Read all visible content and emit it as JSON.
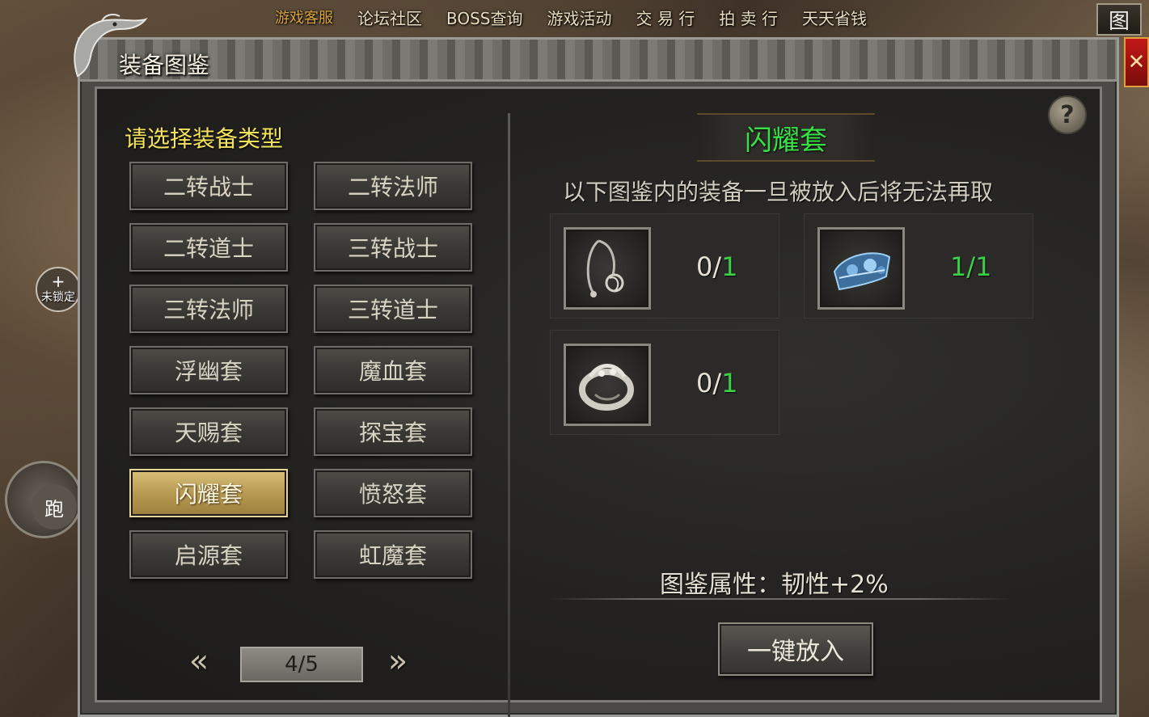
{
  "topbar": {
    "items": [
      "游戏客服",
      "论坛社区",
      "BOSS查询",
      "游戏活动",
      "交 易 行",
      "拍 卖 行",
      "天天省钱"
    ],
    "map_label": "图"
  },
  "hud": {
    "lock_label": "未锁定",
    "run_label": "跑"
  },
  "window": {
    "title": "装备图鉴",
    "close_label": "✕",
    "help_label": "?"
  },
  "left": {
    "prompt": "请选择装备类型",
    "categories": [
      "二转战士",
      "二转法师",
      "二转道士",
      "三转战士",
      "三转法师",
      "三转道士",
      "浮幽套",
      "魔血套",
      "天赐套",
      "探宝套",
      "闪耀套",
      "愤怒套",
      "启源套",
      "虹魔套"
    ],
    "active_category": "闪耀套",
    "pager": {
      "prev": "«",
      "next": "»",
      "page": "4/5"
    }
  },
  "right": {
    "set_name": "闪耀套",
    "notice": "以下图鉴内的装备一旦被放入后将无法再取",
    "slots": [
      {
        "icon": "necklace-icon",
        "have": "0/",
        "need": "1"
      },
      {
        "icon": "bracelet-icon",
        "have": "1/",
        "need": "1"
      },
      {
        "icon": "ring-icon",
        "have": "0/",
        "need": "1"
      }
    ],
    "attribute": "图鉴属性：韧性+2%",
    "put_all_label": "一键放入"
  },
  "colors": {
    "title_yellow": "#f2e35b",
    "set_green": "#38e046",
    "count_green": "#3ad047",
    "active_gold": "#b89a52",
    "close_red": "#c21818"
  }
}
